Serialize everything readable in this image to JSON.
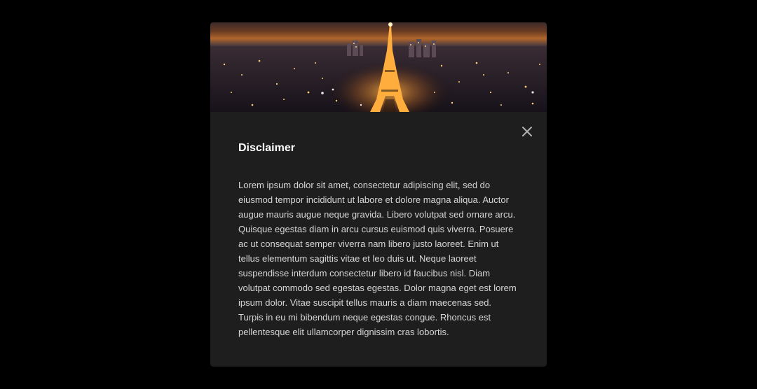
{
  "dialog": {
    "title": "Disclaimer",
    "body": "Lorem ipsum dolor sit amet, consectetur adipiscing elit, sed do eiusmod tempor incididunt ut labore et dolore magna aliqua. Auctor augue mauris augue neque gravida. Libero volutpat sed ornare arcu. Quisque egestas diam in arcu cursus euismod quis viverra. Posuere ac ut consequat semper viverra nam libero justo laoreet. Enim ut tellus elementum sagittis vitae et leo duis ut. Neque laoreet suspendisse interdum consectetur libero id faucibus nisl. Diam volutpat commodo sed egestas egestas. Dolor magna eget est lorem ipsum dolor. Vitae suscipit tellus mauris a diam maecenas sed. Turpis in eu mi bibendum neque egestas congue. Rhoncus est pellentesque elit ullamcorper dignissim cras lobortis.",
    "close_icon": "close-icon",
    "hero_image": "paris-eiffel-tower-night-photo"
  },
  "colors": {
    "page_background": "#000000",
    "dialog_background": "#1e1e1e",
    "title_text": "#ffffff",
    "body_text": "#d6d6d6",
    "close_icon": "#b0b0b0"
  }
}
